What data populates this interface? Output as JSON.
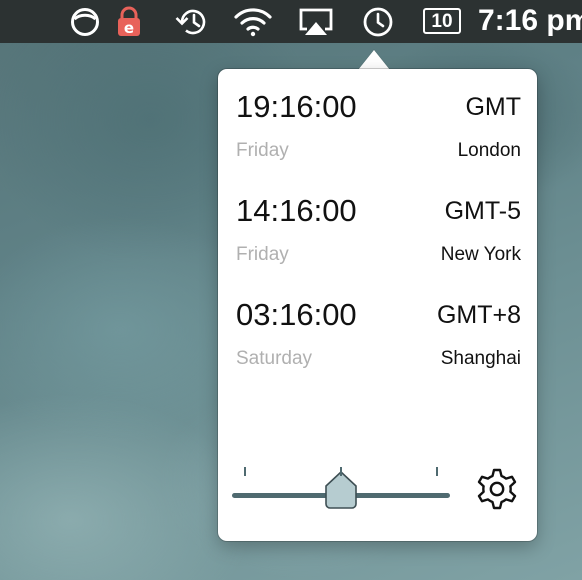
{
  "menubar": {
    "icons": [
      "half-circle-status-icon",
      "lock-e-icon",
      "time-machine-icon",
      "wifi-icon",
      "airplay-icon",
      "clock-icon",
      "calendar-date-icon"
    ],
    "date_badge": "10",
    "clock_text": "7:16 pm"
  },
  "zones": [
    {
      "time": "19:16:00",
      "offset": "GMT",
      "day": "Friday",
      "city": "London"
    },
    {
      "time": "14:16:00",
      "offset": "GMT-5",
      "day": "Friday",
      "city": "New York"
    },
    {
      "time": "03:16:00",
      "offset": "GMT+8",
      "day": "Saturday",
      "city": "Shanghai"
    }
  ],
  "slider": {
    "value": 0.5,
    "tick_positions": [
      0.06,
      0.5,
      0.94
    ]
  },
  "colors": {
    "menubar_bg": "#2c3232",
    "slider_track": "#4f6a70",
    "slider_thumb": "#b6ccd0",
    "secondary_text": "#b0b0b0",
    "lock_icon": "#e8625a"
  }
}
